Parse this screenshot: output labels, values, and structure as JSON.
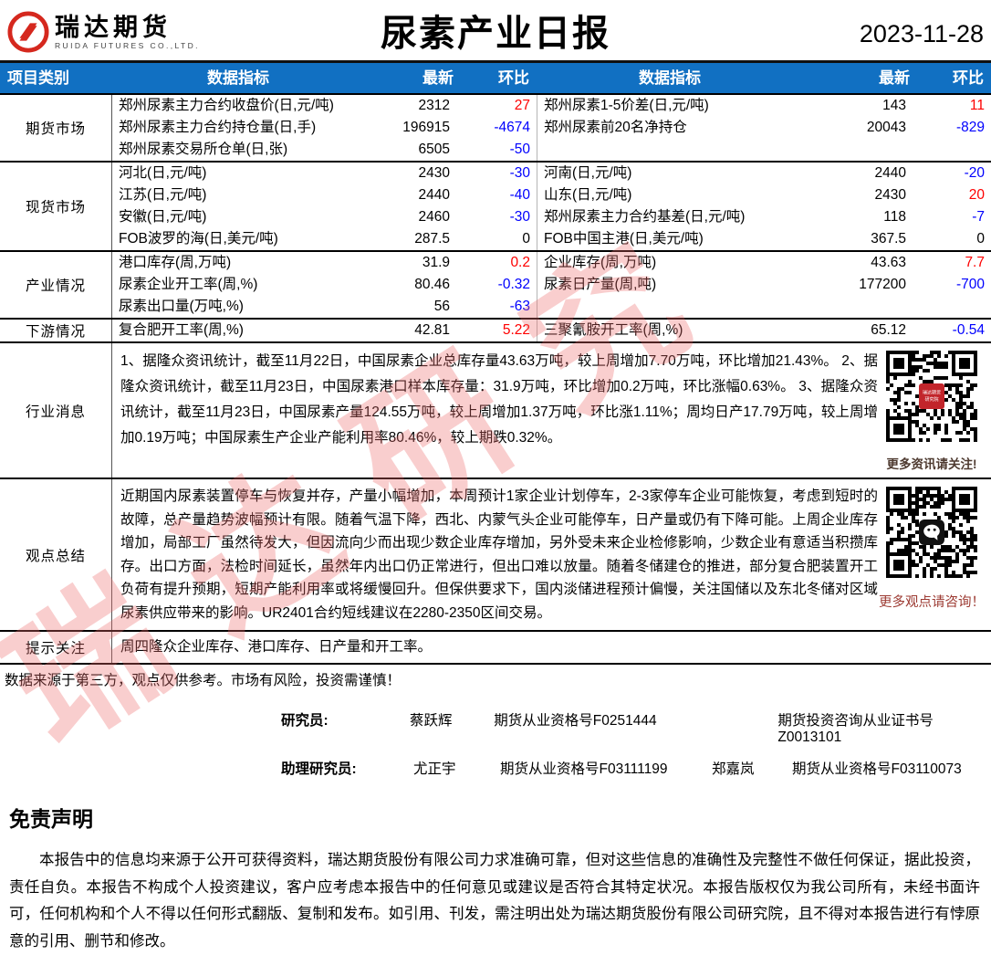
{
  "header": {
    "brand_cn": "瑞达期货",
    "brand_en": "RUIDA FUTURES CO.,LTD.",
    "title": "尿素产业日报",
    "date": "2023-11-28"
  },
  "watermark": "瑞达研究",
  "colors": {
    "header_blue": "#1170c2",
    "positive_red": "#fe0000",
    "negative_blue": "#0000fe",
    "logo_red": "#d5281e"
  },
  "table": {
    "columns": [
      "项目类别",
      "数据指标",
      "最新",
      "环比",
      "数据指标",
      "最新",
      "环比"
    ],
    "sections": [
      {
        "category": "期货市场",
        "rows": [
          {
            "l_label": "郑州尿素主力合约收盘价(日,元/吨)",
            "l_value": "2312",
            "l_chg": "27",
            "l_chg_color": "red",
            "r_label": "郑州尿素1-5价差(日,元/吨)",
            "r_value": "143",
            "r_chg": "11",
            "r_chg_color": "red"
          },
          {
            "l_label": "郑州尿素主力合约持仓量(日,手)",
            "l_value": "196915",
            "l_chg": "-4674",
            "l_chg_color": "blue",
            "r_label": "郑州尿素前20名净持仓",
            "r_value": "20043",
            "r_chg": "-829",
            "r_chg_color": "blue"
          },
          {
            "l_label": "郑州尿素交易所仓单(日,张)",
            "l_value": "6505",
            "l_chg": "-50",
            "l_chg_color": "blue",
            "r_label": "",
            "r_value": "",
            "r_chg": "",
            "r_chg_color": "black"
          }
        ]
      },
      {
        "category": "现货市场",
        "rows": [
          {
            "l_label": "河北(日,元/吨)",
            "l_value": "2430",
            "l_chg": "-30",
            "l_chg_color": "blue",
            "r_label": "河南(日,元/吨)",
            "r_value": "2440",
            "r_chg": "-20",
            "r_chg_color": "blue"
          },
          {
            "l_label": "江苏(日,元/吨)",
            "l_value": "2440",
            "l_chg": "-40",
            "l_chg_color": "blue",
            "r_label": "山东(日,元/吨)",
            "r_value": "2430",
            "r_chg": "20",
            "r_chg_color": "red"
          },
          {
            "l_label": "安徽(日,元/吨)",
            "l_value": "2460",
            "l_chg": "-30",
            "l_chg_color": "blue",
            "r_label": "郑州尿素主力合约基差(日,元/吨)",
            "r_value": "118",
            "r_chg": "-7",
            "r_chg_color": "blue"
          },
          {
            "l_label": "FOB波罗的海(日,美元/吨)",
            "l_value": "287.5",
            "l_chg": "0",
            "l_chg_color": "black",
            "r_label": "FOB中国主港(日,美元/吨)",
            "r_value": "367.5",
            "r_chg": "0",
            "r_chg_color": "black"
          }
        ]
      },
      {
        "category": "产业情况",
        "rows": [
          {
            "l_label": "港口库存(周,万吨)",
            "l_value": "31.9",
            "l_chg": "0.2",
            "l_chg_color": "red",
            "r_label": "企业库存(周,万吨)",
            "r_value": "43.63",
            "r_chg": "7.7",
            "r_chg_color": "red"
          },
          {
            "l_label": "尿素企业开工率(周,%)",
            "l_value": "80.46",
            "l_chg": "-0.32",
            "l_chg_color": "blue",
            "r_label": "尿素日产量(周,吨)",
            "r_value": "177200",
            "r_chg": "-700",
            "r_chg_color": "blue"
          },
          {
            "l_label": "尿素出口量(万吨,%)",
            "l_value": "56",
            "l_chg": "-63",
            "l_chg_color": "blue",
            "r_label": "",
            "r_value": "",
            "r_chg": "",
            "r_chg_color": "black"
          }
        ]
      },
      {
        "category": "下游情况",
        "rows": [
          {
            "l_label": "复合肥开工率(周,%)",
            "l_value": "42.81",
            "l_chg": "5.22",
            "l_chg_color": "red",
            "r_label": "三聚氰胺开工率(周,%)",
            "r_value": "65.12",
            "r_chg": "-0.54",
            "r_chg_color": "blue"
          }
        ]
      }
    ],
    "news": {
      "category": "行业消息",
      "text": "1、据隆众资讯统计，截至11月22日，中国尿素企业总库存量43.63万吨，较上周增加7.70万吨，环比增加21.43%。 2、据隆众资讯统计，截至11月23日，中国尿素港口样本库存量：31.9万吨，环比增加0.2万吨，环比涨幅0.63%。 3、据隆众资讯统计，截至11月23日，中国尿素产量124.55万吨，较上周增加1.37万吨，环比涨1.11%；周均日产17.79万吨，较上周增加0.19万吨；中国尿素生产企业产能利用率80.46%，较上期跌0.32%。",
      "qr_caption": "更多资讯请关注!"
    },
    "summary": {
      "category": "观点总结",
      "text": "近期国内尿素装置停车与恢复并存，产量小幅增加，本周预计1家企业计划停车，2-3家停车企业可能恢复，考虑到短时的故障，总产量趋势波幅预计有限。随着气温下降，西北、内蒙气头企业可能停车，日产量或仍有下降可能。上周企业库存增加，局部工厂虽然待发大，但因流向少而出现少数企业库存增加，另外受未来企业检修影响，少数企业有意适当积攒库存。出口方面，法检时间延长，虽然年内出口仍正常进行，但出口难以放量。随着冬储建仓的推进，部分复合肥装置开工负荷有提升预期，短期产能利用率或将缓慢回升。但保供要求下，国内淡储进程预计偏慢，关注国储以及东北冬储对区域尿素供应带来的影响。UR2401合约短线建议在2280-2350区间交易。",
      "qr_caption": "更多观点请咨询！"
    },
    "reminder": {
      "category": "提示关注",
      "text": "周四隆众企业库存、港口库存、日产量和开工率。"
    }
  },
  "footer": {
    "risk_note": "数据来源于第三方，观点仅供参考。市场有风险，投资需谨慎！",
    "researchers": [
      {
        "role": "研究员:",
        "name": "蔡跃辉",
        "cert": "期货从业资格号F0251444",
        "name2": "",
        "cert2": "期货投资咨询从业证书号Z0013101"
      },
      {
        "role": "助理研究员:",
        "name": "尤正宇",
        "cert": "期货从业资格号F03111199",
        "name2": "郑嘉岚",
        "cert2": "期货从业资格号F03110073"
      }
    ],
    "statement_title": "免责声明",
    "statement_text": "本报告中的信息均来源于公开可获得资料，瑞达期货股份有限公司力求准确可靠，但对这些信息的准确性及完整性不做任何保证，据此投资，责任自负。本报告不构成个人投资建议，客户应考虑本报告中的任何意见或建议是否符合其特定状况。本报告版权仅为我公司所有，未经书面许可，任何机构和个人不得以任何形式翻版、复制和发布。如引用、刊发，需注明出处为瑞达期货股份有限公司研究院，且不得对本报告进行有悖原意的引用、删节和修改。"
  }
}
